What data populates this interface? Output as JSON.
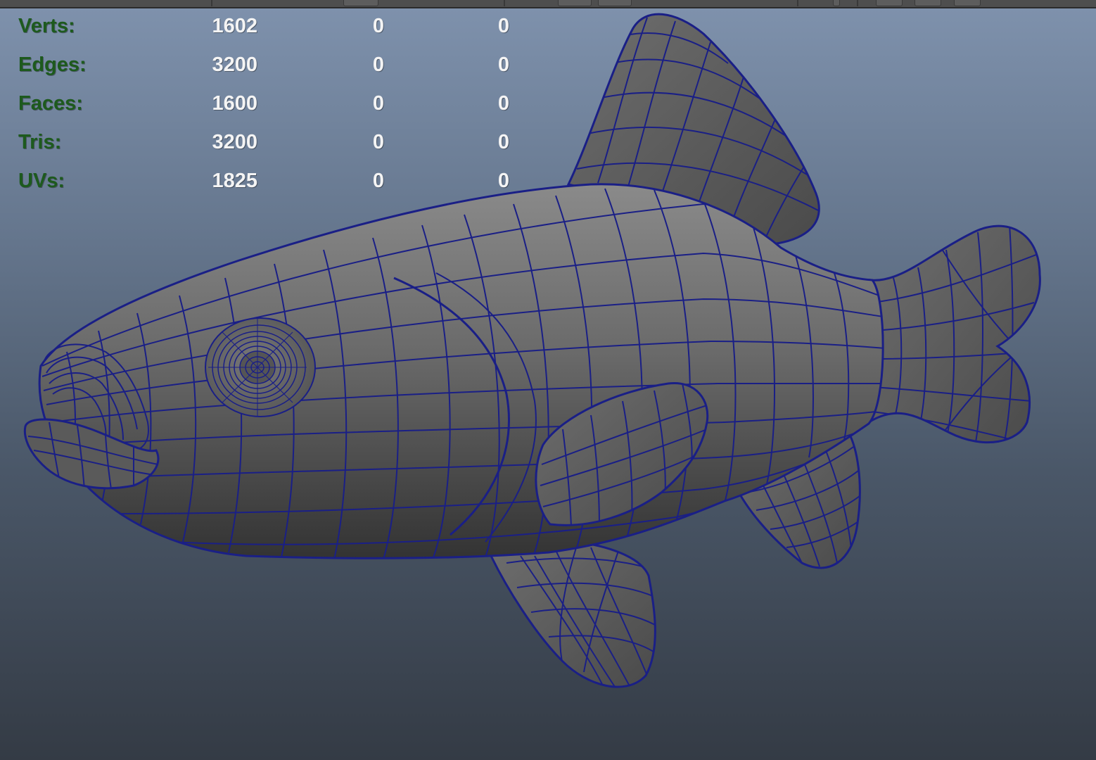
{
  "viewport": {
    "background_top": "#7f92ad",
    "background_bottom": "#343b45",
    "wireframe_color": "#1a1f86",
    "mesh_color": "#5e5e5e"
  },
  "heads_up_display": {
    "rows": [
      {
        "label": "Verts:",
        "values": [
          "1602",
          "0",
          "0"
        ]
      },
      {
        "label": "Edges:",
        "values": [
          "3200",
          "0",
          "0"
        ]
      },
      {
        "label": "Faces:",
        "values": [
          "1600",
          "0",
          "0"
        ]
      },
      {
        "label": "Tris:",
        "values": [
          "3200",
          "0",
          "0"
        ]
      },
      {
        "label": "UVs:",
        "values": [
          "1825",
          "0",
          "0"
        ]
      }
    ]
  }
}
